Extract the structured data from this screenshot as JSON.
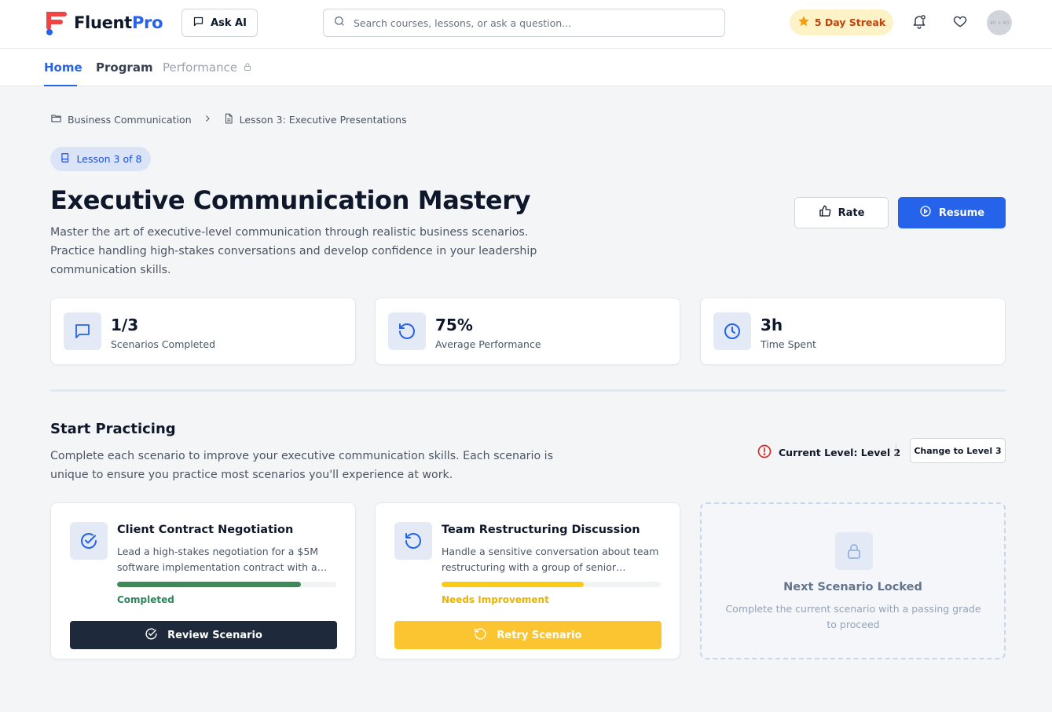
{
  "app": {
    "brand_part1": "Fluent",
    "brand_part2": "Pro",
    "ask_ai_label": "Ask AI",
    "search_placeholder": "Search courses, lessons, or ask a question...",
    "streak_label": "5 Day Streak",
    "avatar_text": "40 × 40"
  },
  "nav": {
    "tabs": [
      {
        "label": "Home",
        "active": true
      },
      {
        "label": "Program",
        "active": false
      },
      {
        "label": "Performance",
        "locked": true
      }
    ]
  },
  "breadcrumb": {
    "items": [
      "Business Communication",
      "Lesson 3: Executive Presentations"
    ]
  },
  "lesson": {
    "pill": "Lesson 3 of 8",
    "title": "Executive Communication Mastery",
    "description": "Master the art of executive-level communication through realistic business scenarios. Practice handling high-stakes conversations and develop confidence in your leadership communication skills.",
    "rate_label": "Rate",
    "resume_label": "Resume"
  },
  "stats": [
    {
      "value": "1/3",
      "label": "Scenarios Completed",
      "icon": "message-square-icon"
    },
    {
      "value": "75%",
      "label": "Average Performance",
      "icon": "rotate-ccw-icon"
    },
    {
      "value": "3h",
      "label": "Time Spent",
      "icon": "clock-icon"
    }
  ],
  "practice": {
    "title": "Start Practicing",
    "description": "Complete each scenario to improve your executive communication skills. Each scenario is unique to ensure you practice most scenarios you'll experience at work.",
    "current_level": "Current Level: Level 2",
    "change_level_label": "Change to Level 3"
  },
  "scenarios": [
    {
      "title": "Client Contract Negotiation",
      "description": "Lead a high-stakes negotiation for a $5M software implementation contract with a multinational client.",
      "progress": 0.84,
      "status": "Completed",
      "status_color": "#2f855a",
      "bar_color": "#3b8a57",
      "button_label": "Review Scenario",
      "button_bg": "#1e293b",
      "button_fg": "#ffffff"
    },
    {
      "title": "Team Restructuring Discussion",
      "description": "Handle a sensitive conversation about team restructuring with a group of senior stakeholders.",
      "progress": 0.65,
      "status": "Needs Improvement",
      "status_color": "#eab308",
      "bar_color": "#facc15",
      "button_label": "Retry Scenario",
      "button_bg": "#fbc531",
      "button_fg": "#ffffff"
    }
  ],
  "locked": {
    "title": "Next Scenario Locked",
    "description": "Complete the current scenario with a passing grade to proceed"
  },
  "colors": {
    "accent": "#2563eb",
    "background": "#f4f5f7",
    "streak_bg": "#fef3c7",
    "streak_fg": "#c2410c"
  }
}
